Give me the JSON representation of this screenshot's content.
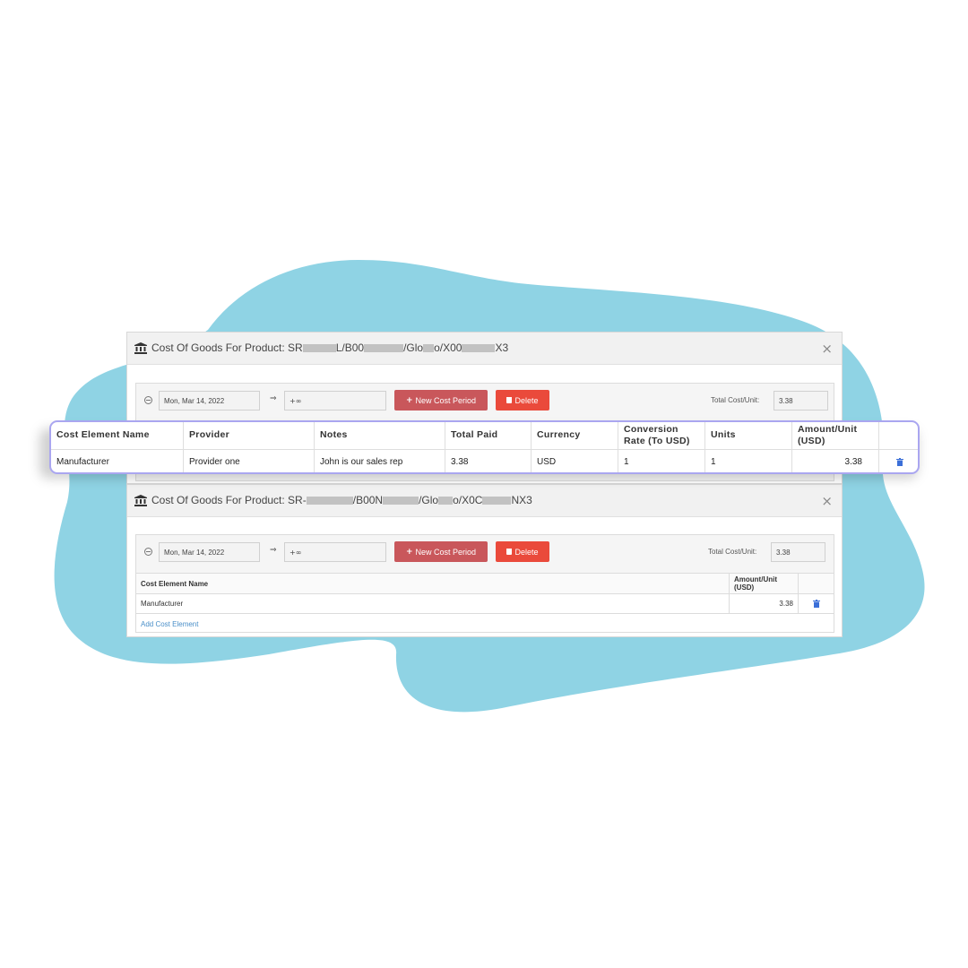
{
  "colors": {
    "blob": "#8fd3e4",
    "new_period_button": "#c9575b",
    "delete_button": "#ea4a3b",
    "highlight_border": "#aaa6f0",
    "link": "#4a8fc8"
  },
  "panel1": {
    "title_parts": [
      "Cost Of Goods For Product: SR",
      "L/B00",
      "/Glo",
      "o/X00",
      "X3"
    ],
    "close_label": "×",
    "start_date": "Mon, Mar 14, 2022",
    "arrow": "⇒",
    "end_date": "+∞",
    "new_period_label": "New Cost Period",
    "delete_label": "Delete",
    "total_label": "Total Cost/Unit:",
    "total_value": "3.38"
  },
  "overlay_table": {
    "headers": [
      "Cost Element Name",
      "Provider",
      "Notes",
      "Total Paid",
      "Currency",
      "Conversion Rate (To USD)",
      "Units",
      "Amount/Unit (USD)"
    ],
    "row": [
      "Manufacturer",
      "Provider one",
      "John is our sales rep",
      "3.38",
      "USD",
      "1",
      "1",
      "3.38"
    ]
  },
  "panel2": {
    "title_parts": [
      "Cost Of Goods For Product: SR-",
      "/B00N",
      "/Glo",
      "o/X0C",
      "NX3"
    ],
    "close_label": "×",
    "start_date": "Mon, Mar 14, 2022",
    "arrow": "⇒",
    "end_date": "+∞",
    "new_period_label": "New Cost Period",
    "delete_label": "Delete",
    "total_label": "Total Cost/Unit:",
    "total_value": "3.38",
    "table_headers": [
      "Cost Element Name",
      "Amount/Unit (USD)"
    ],
    "table_row": [
      "Manufacturer",
      "3.38"
    ],
    "add_link": "Add Cost Element"
  }
}
